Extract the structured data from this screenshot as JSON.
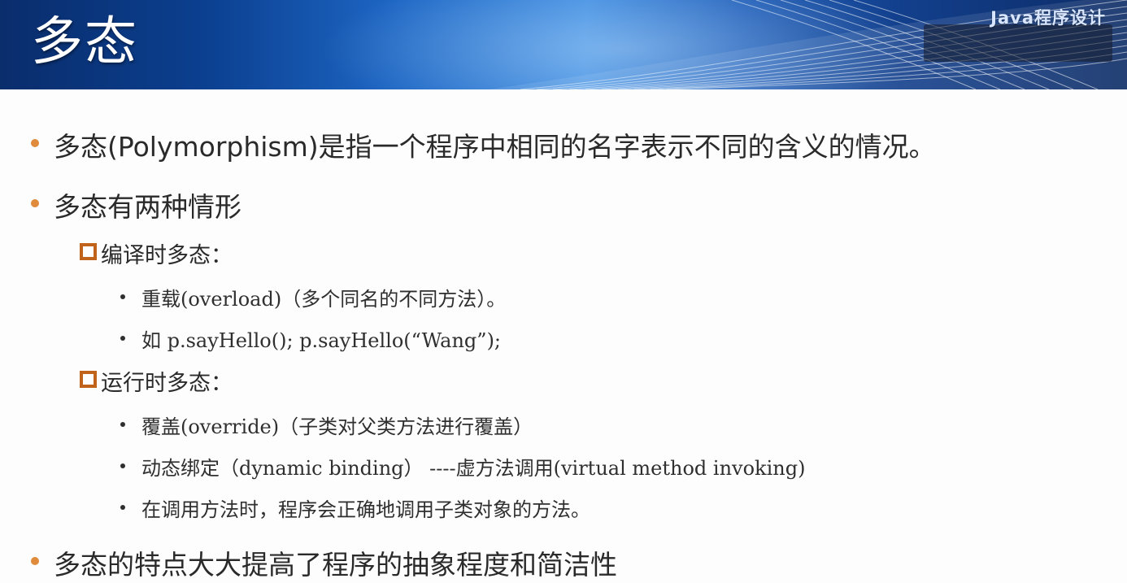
{
  "header": {
    "title": "多态",
    "course_label": "Java程序设计"
  },
  "colors": {
    "accent_bullet": "#e08a3c",
    "box_bullet": "#c1621a",
    "banner_blue": "#0b3f8f"
  },
  "content": {
    "bullet1": "多态(Polymorphism)是指一个程序中相同的名字表示不同的含义的情况。",
    "bullet2": "多态有两种情形",
    "compile_time": {
      "heading": "编译时多态：",
      "items": [
        "重载(overload)（多个同名的不同方法）。",
        "如   p.sayHello();    p.sayHello(“Wang”);"
      ]
    },
    "run_time": {
      "heading": "运行时多态：",
      "items": [
        "覆盖(override)（子类对父类方法进行覆盖）",
        "动态绑定（dynamic binding） ----虚方法调用(virtual method invoking)",
        "在调用方法时，程序会正确地调用子类对象的方法。"
      ]
    },
    "bullet3": "多态的特点大大提高了程序的抽象程度和简洁性"
  }
}
